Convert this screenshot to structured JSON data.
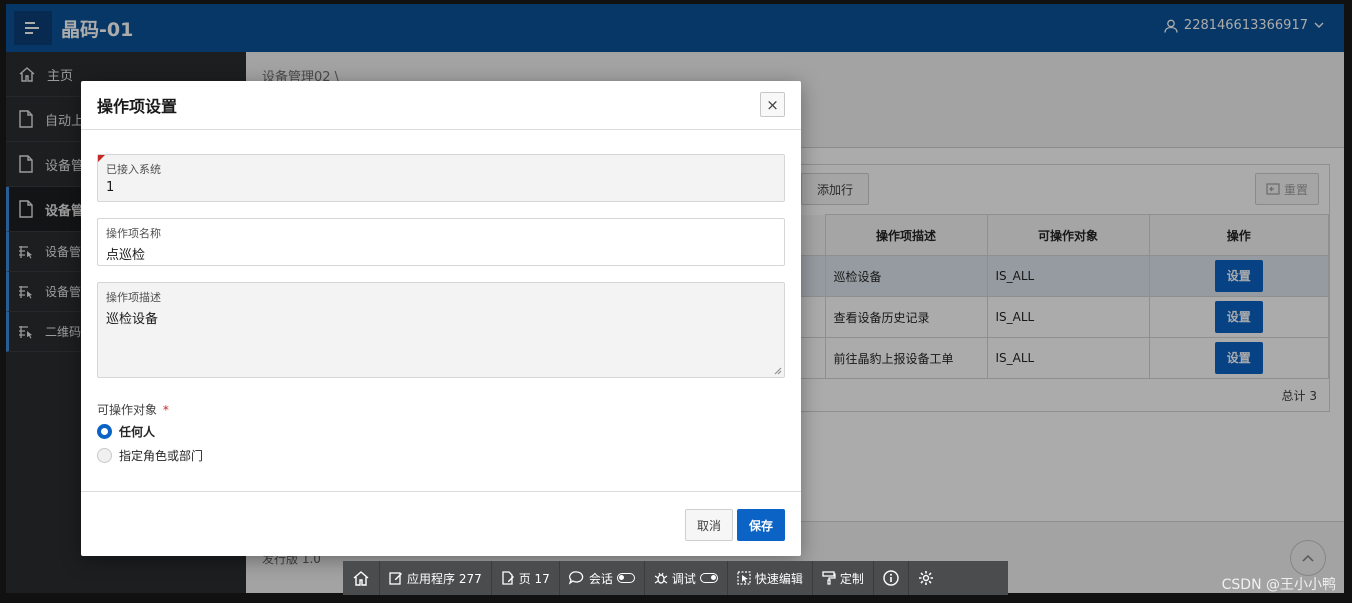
{
  "app": {
    "title": "晶码-01",
    "user": "228146613366917"
  },
  "sidebar": {
    "items": [
      {
        "label": "主页",
        "icon": "home-icon"
      },
      {
        "label": "自动上",
        "icon": "page-icon"
      },
      {
        "label": "设备管",
        "icon": "page-icon"
      },
      {
        "label": "设备管",
        "icon": "page-icon"
      },
      {
        "label": "设备管",
        "icon": "report-icon"
      },
      {
        "label": "设备管",
        "icon": "report-icon"
      },
      {
        "label": "二维码",
        "icon": "report-icon"
      }
    ]
  },
  "page": {
    "breadcrumb": "设备管理02 \\",
    "toolbar": {
      "add_row": "添加行",
      "reset": "重置"
    },
    "table": {
      "headers": [
        "操作项描述",
        "可操作对象",
        "操作"
      ],
      "rows": [
        {
          "desc": "巡检设备",
          "target": "IS_ALL",
          "action": "设置"
        },
        {
          "desc": "查看设备历史记录",
          "target": "IS_ALL",
          "action": "设置"
        },
        {
          "desc": "前往晶豹上报设备工单",
          "target": "IS_ALL",
          "action": "设置"
        }
      ],
      "total": "总计 3"
    },
    "version": "发行版 1.0"
  },
  "dialog": {
    "title": "操作项设置",
    "close": "×",
    "fields": {
      "system": {
        "label": "已接入系统",
        "value": "1"
      },
      "name": {
        "label": "操作项名称",
        "value": "点巡检"
      },
      "desc": {
        "label": "操作项描述",
        "value": "巡检设备"
      }
    },
    "target_label": "可操作对象",
    "required_mark": "*",
    "options": [
      {
        "label": "任何人",
        "selected": true
      },
      {
        "label": "指定角色或部门",
        "selected": false
      }
    ],
    "cancel": "取消",
    "save": "保存"
  },
  "devbar": {
    "app": "应用程序 277",
    "page": "页 17",
    "session": "会话",
    "debug": "调试",
    "quick_edit": "快速编辑",
    "customize": "定制"
  },
  "watermark": "CSDN @王小小鸭",
  "colors": {
    "header": "#0a5299",
    "primary_button": "#0b63c5",
    "sidebar": "#2a2d30"
  }
}
